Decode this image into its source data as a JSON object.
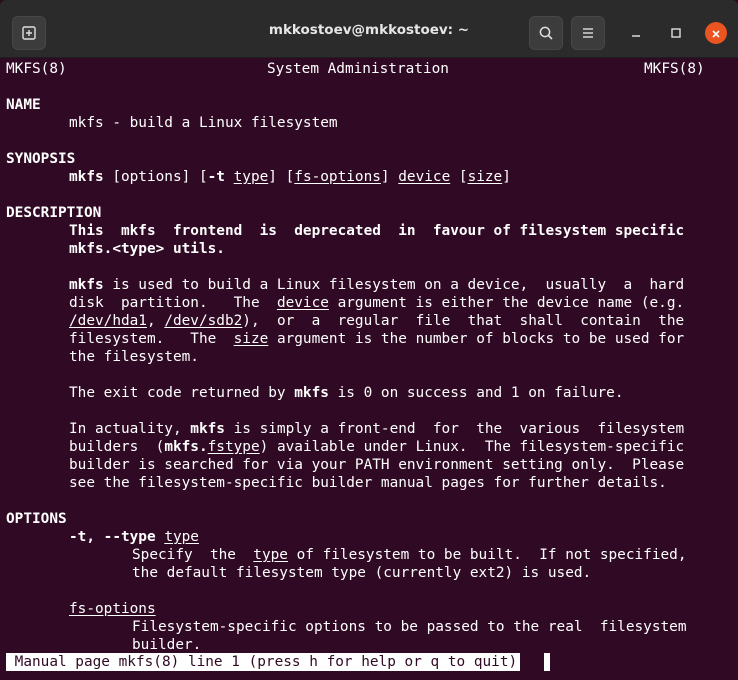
{
  "window": {
    "title": "mkkostoev@mkkostoev: ~",
    "buttons": {
      "new_tab_icon": "new-tab-icon",
      "search_icon": "search-icon",
      "menu_icon": "hamburger-menu-icon",
      "minimize_icon": "minimize-icon",
      "maximize_icon": "maximize-icon",
      "close_icon": "close-icon"
    },
    "colors": {
      "terminal_bg": "#300a24",
      "titlebar_bg": "#2b2b2b",
      "close_accent": "#e95420"
    }
  },
  "man": {
    "header_left": "MKFS(8)",
    "header_center": "System Administration",
    "header_right": "MKFS(8)",
    "name_heading": "NAME",
    "name_text": "mkfs - build a Linux filesystem",
    "synopsis_heading": "SYNOPSIS",
    "synopsis": {
      "cmd": "mkfs",
      "p1": " [options] [",
      "t_flag": "-t",
      "sp1": " ",
      "type": "type",
      "p2": "] [",
      "fs_options": "fs-options",
      "p3": "] ",
      "device": "device",
      "p4": " [",
      "size": "size",
      "p5": "]"
    },
    "description_heading": "DESCRIPTION",
    "desc_deprecated_1": "This  mkfs  frontend  is  deprecated  in  favour of filesystem specific",
    "desc_deprecated_2": "mkfs.<type> utils.",
    "para1": {
      "l1_cmd": "mkfs",
      "l1_rest": " is used to build a Linux filesystem on a device,  usually  a  hard",
      "l2_a": "disk  partition.   The  ",
      "l2_device": "device",
      "l2_b": " argument is either the device name (e.g.",
      "l3_dev1": "/dev/hda1",
      "l3_a": ", ",
      "l3_dev2": "/dev/sdb2",
      "l3_b": "),  or  a  regular  file  that  shall  contain  the",
      "l4_a": "filesystem.   The  ",
      "l4_size": "size",
      "l4_b": " argument is the number of blocks to be used for",
      "l5": "the filesystem."
    },
    "para2": {
      "a": "The exit code returned by ",
      "cmd": "mkfs",
      "b": " is 0 on success and 1 on failure."
    },
    "para3": {
      "l1_a": "In actuality, ",
      "l1_cmd": "mkfs",
      "l1_b": " is simply a front-end  for  the  various  filesystem",
      "l2_a": "builders  (",
      "l2_cmd": "mkfs.",
      "l2_fstype": "fstype",
      "l2_b": ") available under Linux.  The filesystem-specific",
      "l3": "builder is searched for via your PATH environment setting only.  Please",
      "l4": "see the filesystem-specific builder manual pages for further details."
    },
    "options_heading": "OPTIONS",
    "opt_t": {
      "flag": "-t, --type",
      "sp": " ",
      "arg": "type",
      "d1_a": "Specify  the  ",
      "d1_type": "type",
      "d1_b": " of filesystem to be built.  If not specified,",
      "d2": "the default filesystem type (currently ext2) is used."
    },
    "opt_fs": {
      "name": "fs-options",
      "d1": "Filesystem-specific options to be passed to the real  filesystem",
      "d2": "builder."
    },
    "status_line": " Manual page mkfs(8) line 1 (press h for help or q to quit)"
  }
}
